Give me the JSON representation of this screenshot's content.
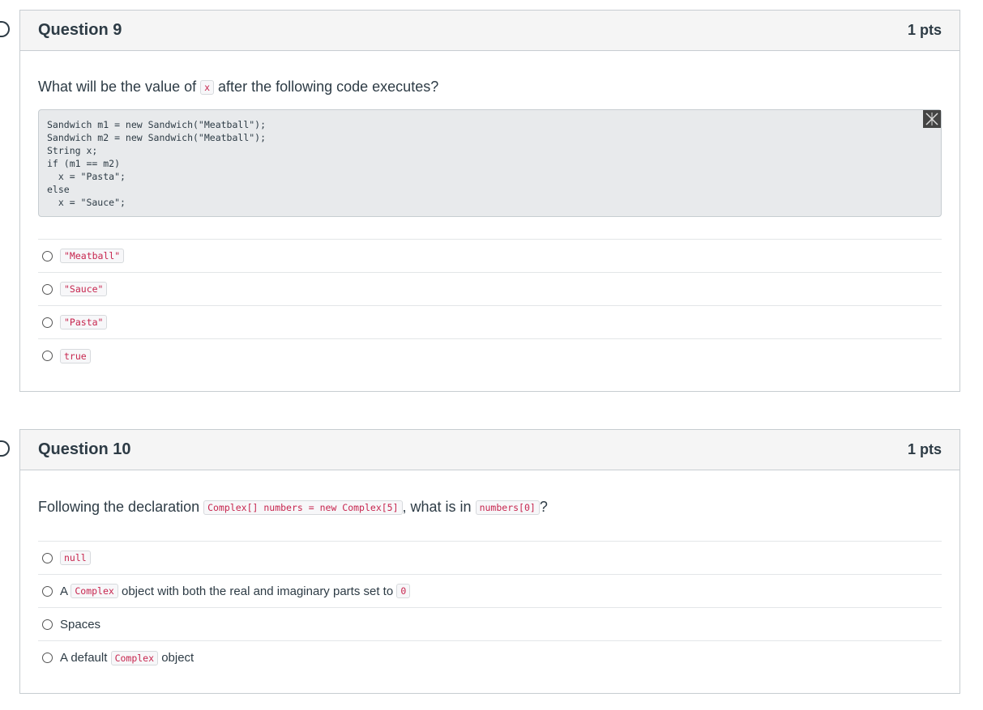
{
  "questions": [
    {
      "title": "Question 9",
      "points": "1 pts",
      "prompt_before": "What will be the value of ",
      "prompt_code": "x",
      "prompt_after": " after the following code executes?",
      "code_block": "Sandwich m1 = new Sandwich(\"Meatball\");\nSandwich m2 = new Sandwich(\"Meatball\");\nString x;\nif (m1 == m2)\n  x = \"Pasta\";\nelse\n  x = \"Sauce\";",
      "code_block_icon": "expand-code-icon",
      "answers": [
        {
          "code": "\"Meatball\""
        },
        {
          "code": "\"Sauce\""
        },
        {
          "code": "\"Pasta\""
        },
        {
          "code": "true"
        }
      ]
    },
    {
      "title": "Question 10",
      "points": "1 pts",
      "prompt_before": "Following the declaration ",
      "prompt_code1": "Complex[] numbers = new Complex[5]",
      "prompt_mid": ", what is in ",
      "prompt_code2": "numbers[0]",
      "prompt_after": "?",
      "answers": [
        {
          "code": "null"
        },
        {
          "pre": "A ",
          "code": "Complex",
          "post": " object with both the real and imaginary parts set to ",
          "code2": "0"
        },
        {
          "pre": "Spaces"
        },
        {
          "pre": "A default ",
          "code": "Complex",
          "post": " object"
        }
      ]
    }
  ],
  "colors": {
    "inline_code_text": "#c7254e",
    "header_bg": "#f5f5f5",
    "border": "#c7cdd1",
    "text": "#2d3b45"
  }
}
